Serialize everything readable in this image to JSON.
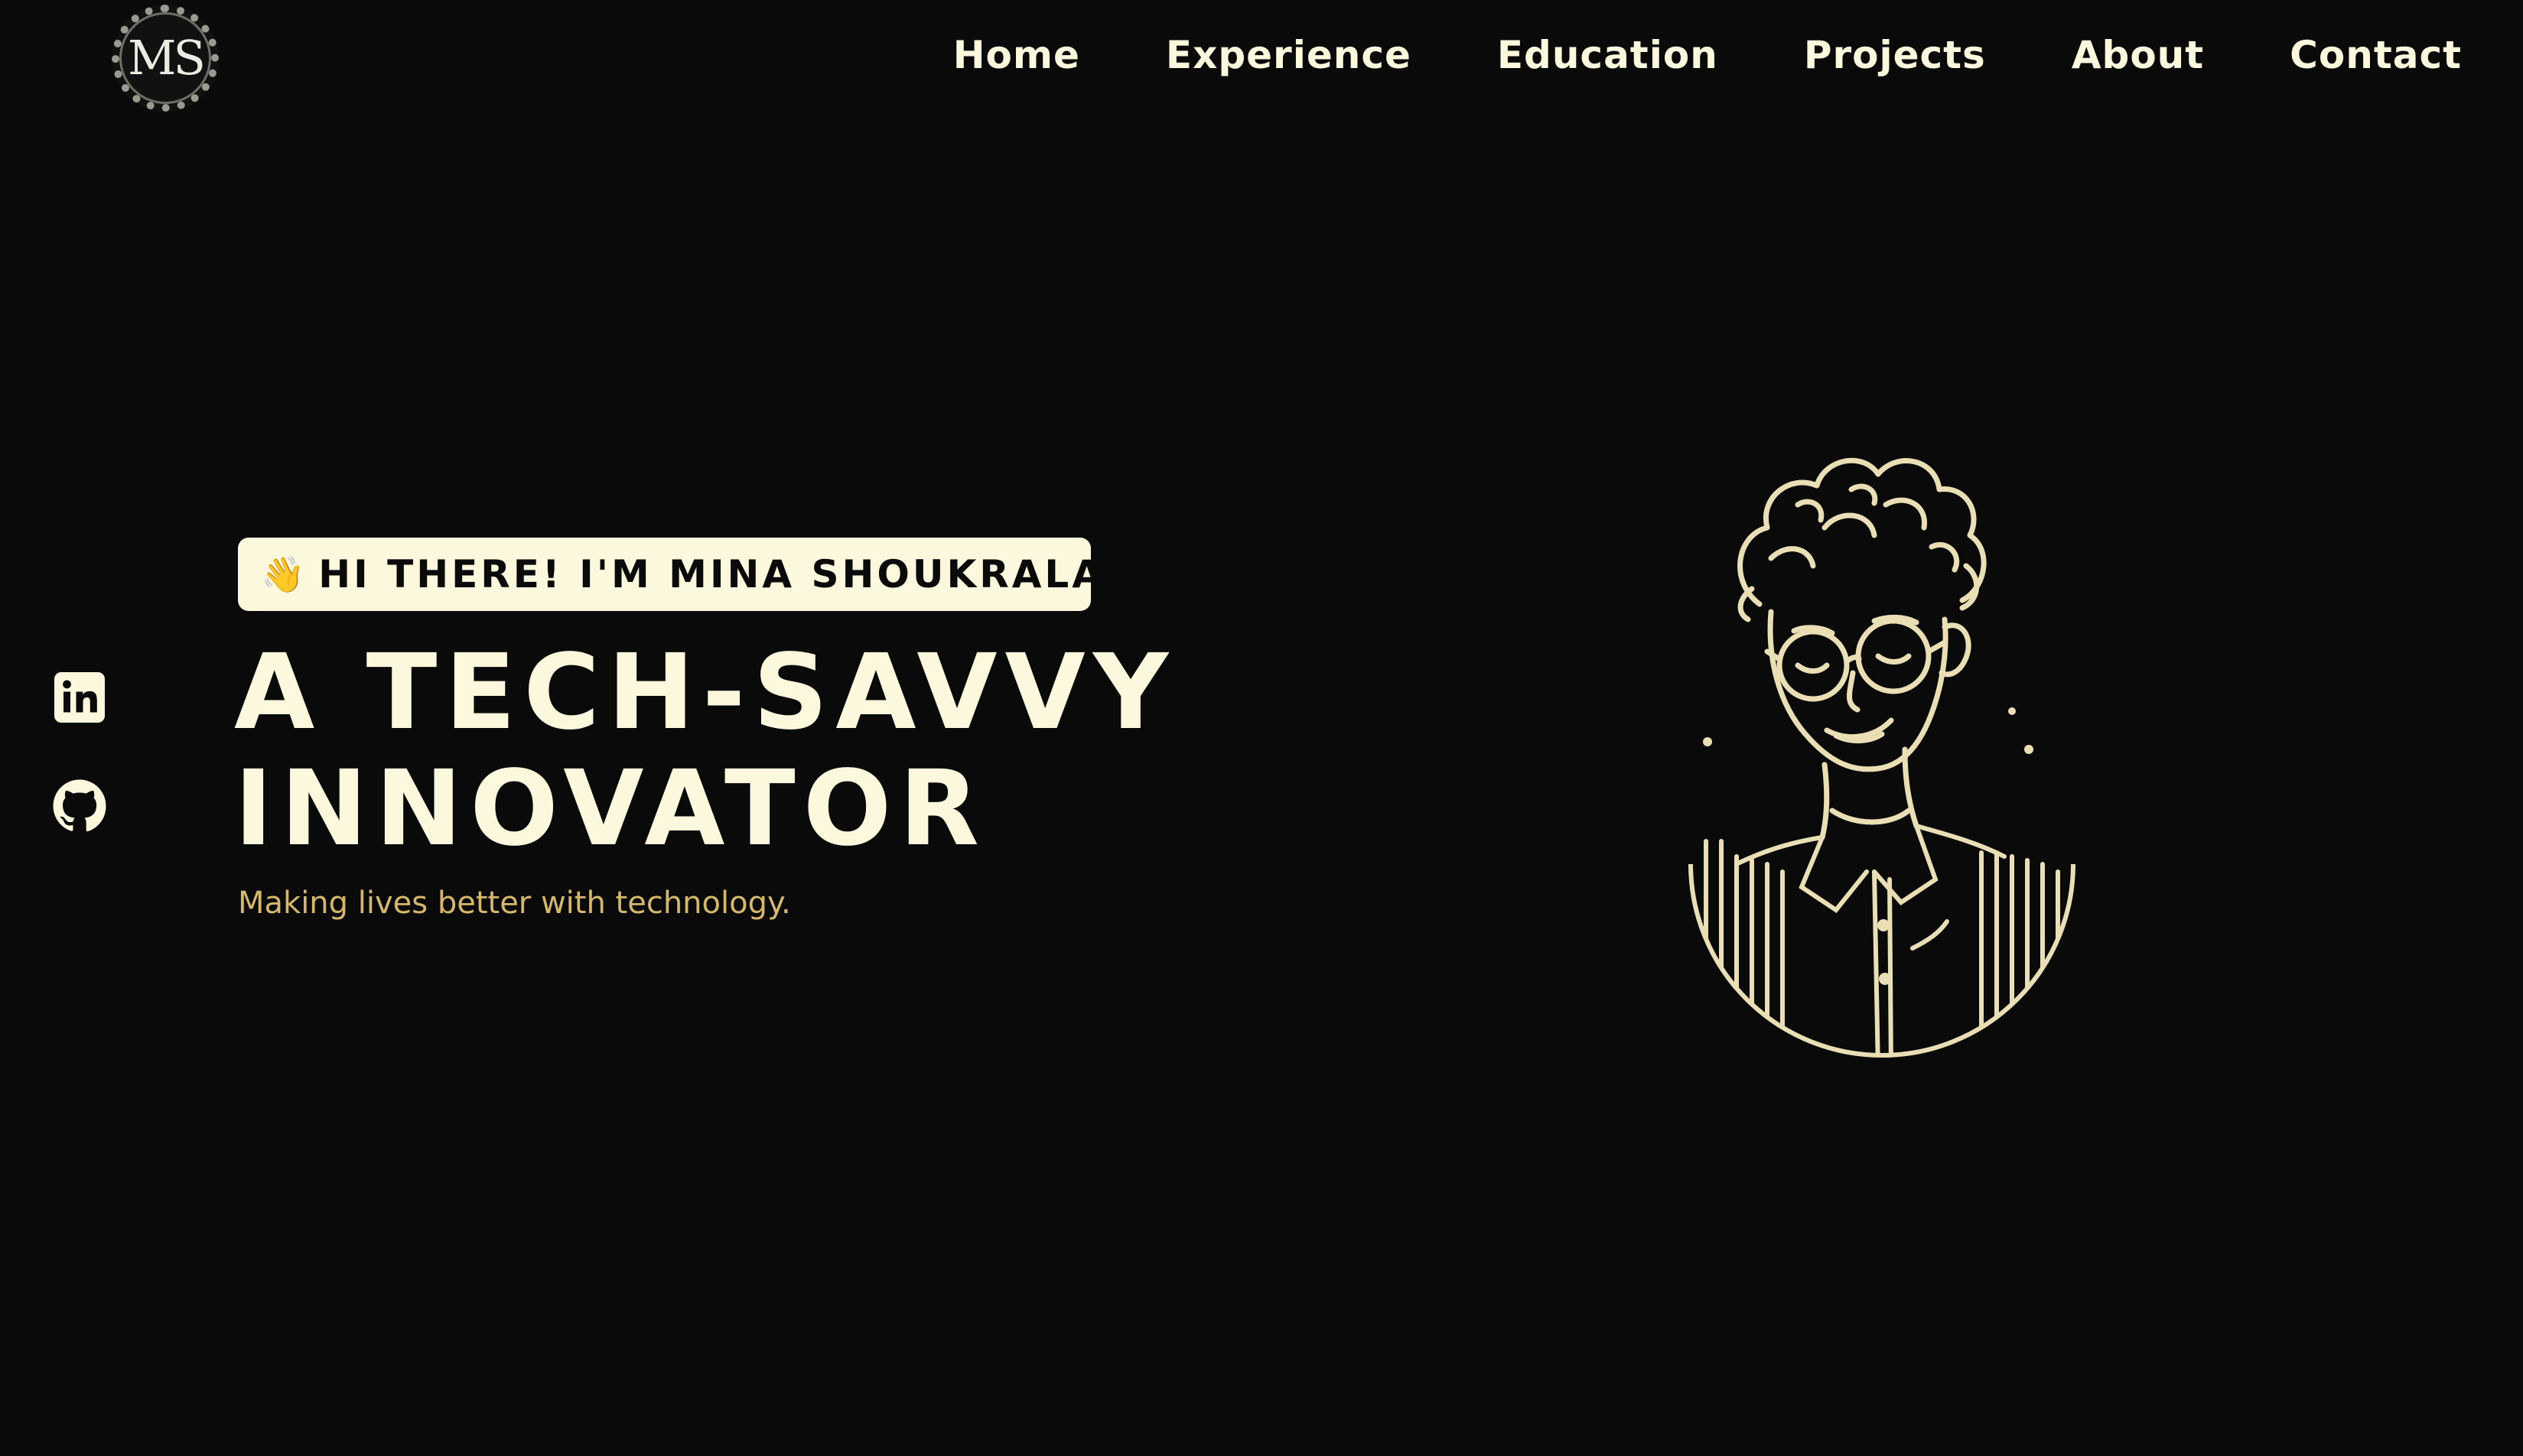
{
  "logo": {
    "text": "MS"
  },
  "nav": {
    "items": [
      {
        "label": "Home"
      },
      {
        "label": "Experience"
      },
      {
        "label": "Education"
      },
      {
        "label": "Projects"
      },
      {
        "label": "About"
      },
      {
        "label": "Contact"
      }
    ]
  },
  "social": [
    {
      "icon": "linkedin-icon"
    },
    {
      "icon": "github-icon"
    }
  ],
  "hero": {
    "wave": "👋",
    "greeting": "HI THERE! I'M MINA SHOUKRALA",
    "headline_line1": "A TECH-SAVVY",
    "headline_line2": "INNOVATOR",
    "tagline": "Making lives better with technology."
  },
  "colors": {
    "background": "#0a0a0a",
    "text": "#fbf8dd",
    "accent": "#d6b86a",
    "badge": "#fbf8dd"
  }
}
